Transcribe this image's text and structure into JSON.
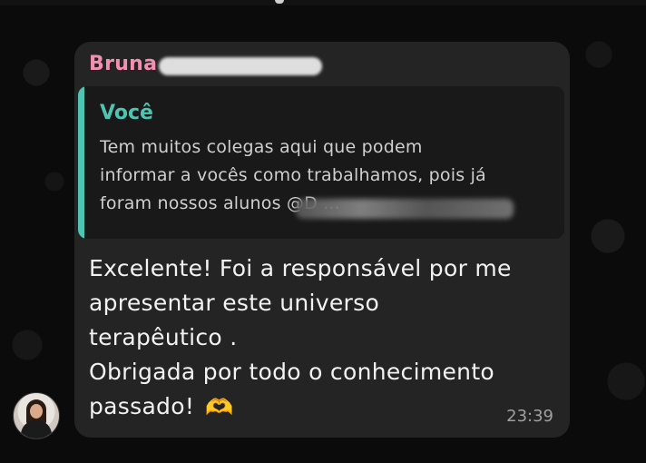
{
  "chat": {
    "sender_name": "Bruna",
    "quote": {
      "author": "Você",
      "text": "Tem muitos colegas aqui que podem\ninformar a vocês como trabalhamos, pois já\nforam nossos alunos @D                              ..."
    },
    "message": {
      "text": "Excelente! Foi a responsável por me\napresentar este universo\nterapêutico .\nObrigada por todo o conhecimento\npassado!",
      "emoji": "🫶",
      "timestamp": "23:39"
    }
  },
  "colors": {
    "sender": "#f48fb1",
    "quote_accent": "#4ec5b2",
    "bubble": "#242424",
    "background": "#0b0b0b"
  }
}
